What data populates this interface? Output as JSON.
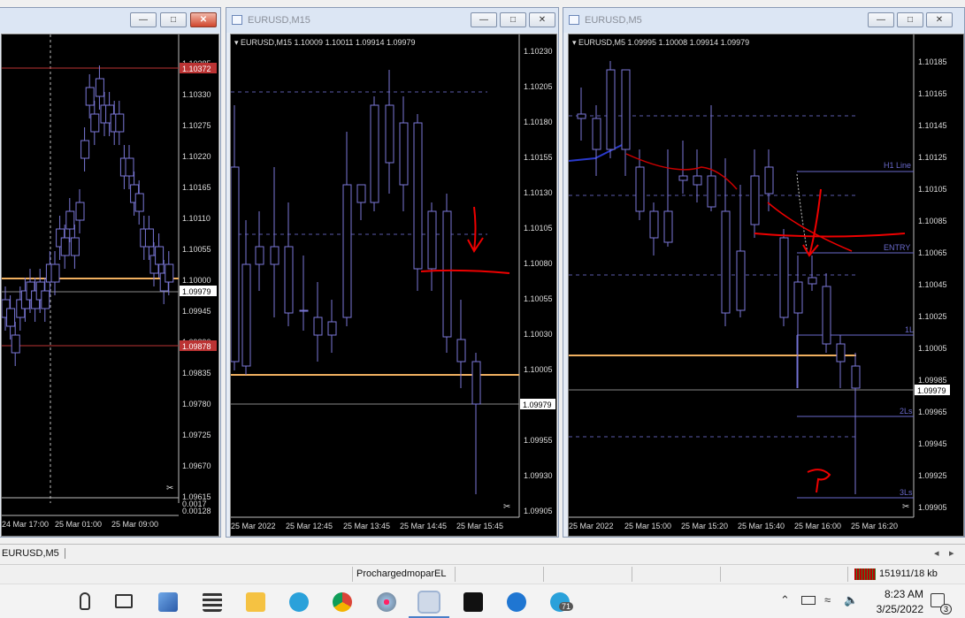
{
  "windows": [
    {
      "title": "",
      "id": "left"
    },
    {
      "title": "EURUSD,M15",
      "id": "mid"
    },
    {
      "title": "EURUSD,M5",
      "id": "right"
    }
  ],
  "left_chart": {
    "price_labels": [
      "1.10385",
      "1.10330",
      "1.10275",
      "1.10220",
      "1.10165",
      "1.10110",
      "1.10055",
      "1.10000",
      "1.09945",
      "1.09890",
      "1.09835",
      "1.09780",
      "1.09725",
      "1.09670",
      "1.09615"
    ],
    "red_price_top": "1.10372",
    "red_price_bottom": "1.09878",
    "current_price": "1.09979",
    "sub_labels": [
      "0.0017",
      "0.00128"
    ],
    "time_labels": [
      "24 Mar 17:00",
      "25 Mar 01:00",
      "25 Mar 09:00"
    ]
  },
  "mid_chart": {
    "header": "EURUSD,M15  1.10009 1.10011 1.09914 1.09979",
    "price_labels": [
      "1.10230",
      "1.10205",
      "1.10180",
      "1.10155",
      "1.10130",
      "1.10105",
      "1.10080",
      "1.10055",
      "1.10030",
      "1.10005",
      "1.09979",
      "1.09955",
      "1.09930",
      "1.09905"
    ],
    "current_price": "1.09979",
    "time_labels": [
      "25 Mar 2022",
      "25 Mar 12:45",
      "25 Mar 13:45",
      "25 Mar 14:45",
      "25 Mar 15:45"
    ]
  },
  "right_chart": {
    "header": "EURUSD,M5  1.09995 1.10008 1.09914 1.09979",
    "price_labels": [
      "1.10185",
      "1.10165",
      "1.10145",
      "1.10125",
      "1.10105",
      "1.10085",
      "1.10065",
      "1.10045",
      "1.10025",
      "1.10005",
      "1.09985",
      "1.09965",
      "1.09945",
      "1.09925",
      "1.09905"
    ],
    "current_price": "1.09979",
    "line_labels": {
      "h1": "H1 Line",
      "entry": "ENTRY",
      "l1": "1L",
      "l2": "2Ls",
      "l3": "3Ls"
    },
    "time_labels": [
      "25 Mar 2022",
      "25 Mar 15:00",
      "25 Mar 15:20",
      "25 Mar 15:40",
      "25 Mar 16:00",
      "25 Mar 16:20"
    ]
  },
  "tabbar": {
    "active_tab": "EURUSD,M5"
  },
  "statusbar": {
    "profile": "ProchargedmoparEL",
    "traffic": "151911/18 kb"
  },
  "taskbar": {
    "time": "8:23 AM",
    "date": "3/25/2022",
    "telegram_badge": "71",
    "notif_count": "3"
  }
}
